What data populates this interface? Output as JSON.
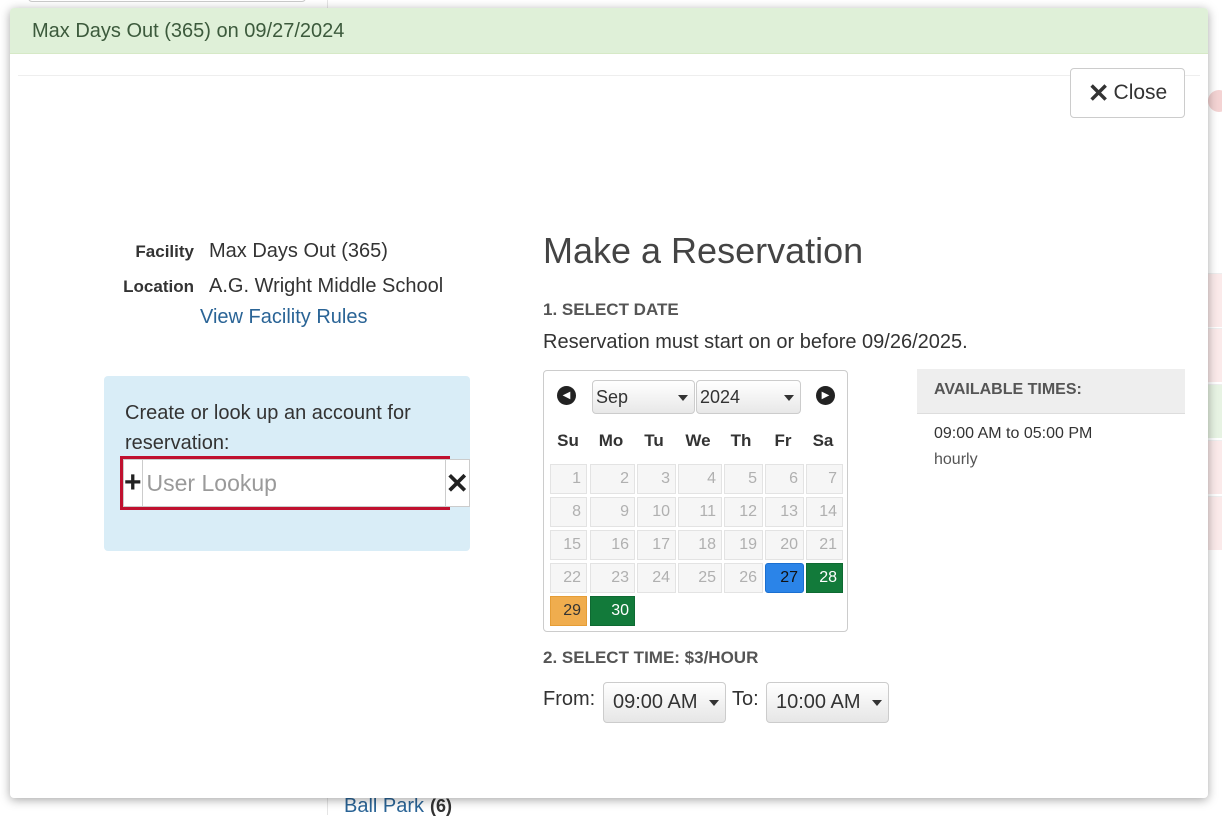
{
  "alert": {
    "text": "Max Days Out (365) on 09/27/2024"
  },
  "close_button": {
    "label": "Close"
  },
  "facility": {
    "facility_label": "Facility",
    "facility_value": "Max Days Out (365)",
    "location_label": "Location",
    "location_value": "A.G. Wright Middle School",
    "rules_link": "View Facility Rules"
  },
  "lookup": {
    "prompt": "Create or look up an account for reservation:",
    "placeholder": "User Lookup",
    "add_icon": "plus-icon",
    "clear_icon": "x-icon"
  },
  "reservation": {
    "title": "Make a Reservation",
    "step1": "1. SELECT DATE",
    "note": "Reservation must start on or before 09/26/2025.",
    "step2": "2. SELECT TIME: $3/HOUR"
  },
  "calendar": {
    "month": "Sep",
    "year": "2024",
    "weekdays": [
      "Su",
      "Mo",
      "Tu",
      "We",
      "Th",
      "Fr",
      "Sa"
    ],
    "weeks": [
      [
        "1",
        "2",
        "3",
        "4",
        "5",
        "6",
        "7"
      ],
      [
        "8",
        "9",
        "10",
        "11",
        "12",
        "13",
        "14"
      ],
      [
        "15",
        "16",
        "17",
        "18",
        "19",
        "20",
        "21"
      ],
      [
        "22",
        "23",
        "24",
        "25",
        "26",
        "27",
        "28"
      ],
      [
        "29",
        "30"
      ]
    ],
    "selected_day": "27",
    "available_days": [
      "28",
      "30"
    ],
    "highlighted_day": "29",
    "colors": {
      "selected": "#2b84e8",
      "available": "#127a3a",
      "highlighted": "#f0ad4e"
    }
  },
  "available_times": {
    "title": "AVAILABLE TIMES:",
    "slot": "09:00 AM to 05:00 PM",
    "unit": "hourly"
  },
  "time": {
    "from_label": "From:",
    "from_value": "09:00 AM",
    "to_label": "To:",
    "to_value": "10:00 AM"
  },
  "background": {
    "link_text": "Ball Park",
    "link_count": "6"
  }
}
